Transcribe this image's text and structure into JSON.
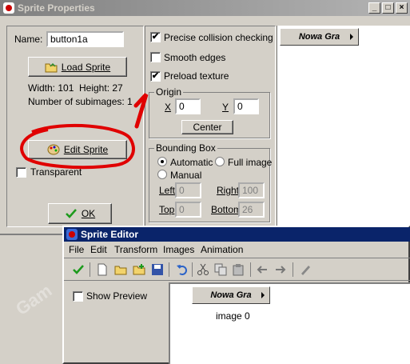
{
  "sprite_props": {
    "title": "Sprite Properties",
    "name_label": "Name:",
    "name_value": "button1a",
    "load_sprite": "Load Sprite",
    "width_text": "Width: 101",
    "height_text": "Height: 27",
    "subimages_text": "Number of subimages: 1",
    "edit_sprite": "Edit Sprite",
    "transparent": "Transparent",
    "ok": "OK",
    "precise": "Precise collision checking",
    "smooth": "Smooth edges",
    "preload": "Preload texture",
    "origin_legend": "Origin",
    "origin_x_label": "X",
    "origin_x": "0",
    "origin_y_label": "Y",
    "origin_y": "0",
    "center": "Center",
    "bbox_legend": "Bounding Box",
    "automatic": "Automatic",
    "full_image": "Full image",
    "manual": "Manual",
    "left_label": "Left",
    "left_value": "0",
    "right_label": "Right",
    "right_value": "100",
    "top_label": "Top",
    "top_value": "0",
    "bottom_label": "Bottom",
    "bottom_value": "26",
    "preview_button": "Nowa Gra"
  },
  "annotation": {
    "number": "1"
  },
  "window_buttons": {
    "min": "_",
    "max": "□",
    "close": "×"
  },
  "sprite_editor": {
    "title": "Sprite Editor",
    "menu": [
      "File",
      "Edit",
      "Transform",
      "Images",
      "Animation"
    ],
    "show_preview": "Show Preview",
    "image_button": "Nowa Gra",
    "image_label": "image 0"
  },
  "watermark": "Gam",
  "colors": {
    "annotation_red": "#e00000",
    "editor_title": "#0a246a"
  }
}
